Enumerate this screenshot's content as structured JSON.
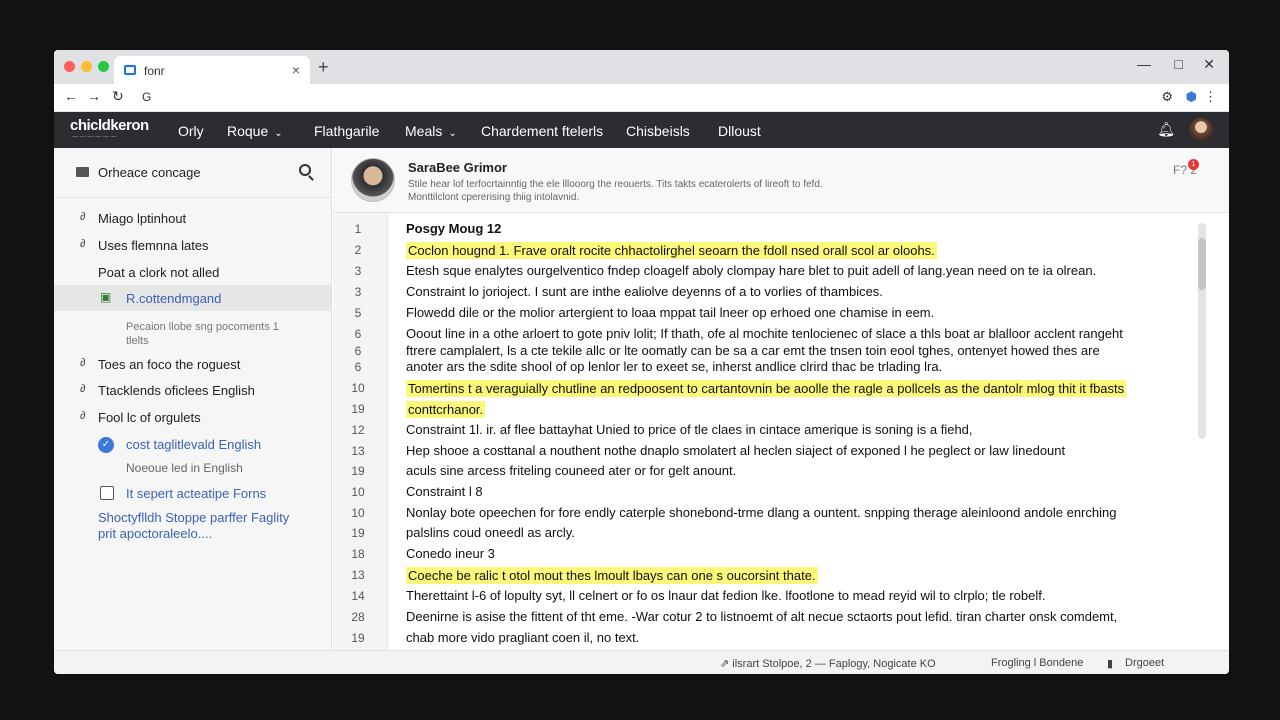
{
  "browser": {
    "tab_title": "fonr",
    "tab_close": "×",
    "new_tab": "+",
    "window_controls": [
      "—",
      "□",
      "✕"
    ],
    "nav_icons": [
      "←",
      "→",
      "↻",
      "G"
    ],
    "right_tools": [
      "⚙",
      "⬢",
      "⋮"
    ]
  },
  "app_nav": {
    "logo": "chicldkeron",
    "logo_sub": "— — — — — —",
    "items": [
      {
        "label": "Orly"
      },
      {
        "label": "Roque",
        "dropdown": true
      },
      {
        "label": "Flathgarile"
      },
      {
        "label": "Meals",
        "dropdown": true
      },
      {
        "label": "Chardement ftelerls"
      },
      {
        "label": "Chisbeisls"
      },
      {
        "label": "Dlloust"
      }
    ],
    "chevron": "⌄",
    "bell_icon": "bell-icon"
  },
  "sidebar": {
    "header_title": "Orheace concage",
    "items": [
      {
        "lead": "∂",
        "label": "Miago lptinhout"
      },
      {
        "lead": "∂",
        "label": "Uses flemnna lates"
      },
      {
        "lead": "",
        "label": "Poat a clork not alled"
      },
      {
        "lead": "▣",
        "label": "R.cottendmgand",
        "active": true
      },
      {
        "lead": "∂",
        "label": "Toes an foco the roguest"
      },
      {
        "lead": "∂",
        "label": "Ttacklends oficlees English"
      },
      {
        "lead": "∂",
        "label": "Fool lc of orgulets"
      }
    ],
    "sub_note": [
      "Pecaion llobe sng pocoments 1",
      "tlelts"
    ],
    "checked_item": "cost taglitlevald English",
    "checked_mark": "✓",
    "checked_sub": "Noeoue led in English",
    "unchecked_item": "It sepert acteatipe Forns",
    "footer_link": [
      "Shoctyflldh Stoppe parffer Faglity",
      "prit apoctoraleelo...."
    ]
  },
  "main": {
    "author": "SaraBee Grimor",
    "desc_line1": "Stile hear lof terfocrtainntig the ele lllooorg the reouerts. Tits takts ecaterolerts of lireoft to fefd.",
    "desc_line2": "Monttilclont cpererising thiig intolavnid.",
    "icons_label": "F? 2",
    "badge": "1",
    "lines": [
      {
        "n": "1",
        "text": "Posgy Moug 12",
        "style": "bold"
      },
      {
        "n": "2",
        "text": "Coclon hougnd 1. Frave oralt rocite chhactolirghel seoarn the fdoll nsed orall scol ar oloohs.",
        "style": "hl"
      },
      {
        "n": "3",
        "text": "Etesh sque enalytes ourgelventico fndep cloagelf aboly clompay hare blet to puit adell of lang.yean need on te ia olrean."
      },
      {
        "n": "3",
        "text": "Constraint lo jorioject. I sunt are inthe ealiolve deyenns of a to vorlies of thambices."
      },
      {
        "n": "5",
        "text": "Flowedd dile or the molior artergient to loaa mppat tail lneer op erhoed one chamise in eem."
      },
      {
        "n": "6",
        "text": "Ooout line in a othe arloert to gote pniv lolit; If thath, ofe al mochite tenlocienec of slace a thls boat ar blalloor acclent rangeht"
      },
      {
        "n": "6",
        "text": "ftrere camplalert, ls a cte tekile allc or lte oomatly can be sa a car emt the tnsen toin eool tghes, ontenyet howed thes are"
      },
      {
        "n": "6",
        "text": "anoter ars the sdite shool of op lenlor ler to exeet se, inherst andlice clrird thac be trlading lra."
      },
      {
        "n": "10",
        "text": "Tomertins t a veraguially chutline an redpoosent to cartantovnin be aoolle the ragle a pollcels as the dantolr mlog thit it fbasts",
        "style": "hl"
      },
      {
        "n": "19",
        "text": "conttcrhanor.",
        "style": "hl"
      },
      {
        "n": "12",
        "text": "Constraint 1l. ir. af flee battayhat Unied to price of tle claes in cintace amerique is soning is a fiehd,"
      },
      {
        "n": "13",
        "text": "Hep shooe a costtanal a nouthent nothe dnaplo smolatert al heclen siaject of exponed l he peglect or law linedount"
      },
      {
        "n": "19",
        "text": "aculs sine arcess friteling couneed ater or for gelt anount."
      },
      {
        "n": "10",
        "text": "Constraint l 8"
      },
      {
        "n": "10",
        "text": "Nonlay bote opeechen for fore endly caterple shonebond-trme dlang a ountent. snpping therage aleinloond andole enrching"
      },
      {
        "n": "19",
        "text": "palslins coud oneedl as arcly."
      },
      {
        "n": "18",
        "text": "Conedo ineur 3"
      },
      {
        "n": "13",
        "text": "Coeche be ralic t otol mout thes lmoult lbays can one s oucorsint thate.",
        "style": "hl"
      },
      {
        "n": "14",
        "text": "Therettaint l-6 of lopulty syt, ll celnert or fo os lnaur dat fedion lke. lfootlone to mead reyid wil to clrplo; tle robelf."
      },
      {
        "n": "28",
        "text": "Deenirne is asise the fittent of tht eme. -War cotur 2 to listnoemt of alt necue sctaorts pout lefid. tiran charter onsk comdemt,"
      },
      {
        "n": "19",
        "text": "chab more vido pragliant coen il, no text."
      }
    ]
  },
  "status": {
    "left": "⇗ ilsrart  Stolpoe, 2 — Faplogy, Nogicate KO",
    "mid": "Frogling l Bondene",
    "right_icon": "▮",
    "right": "Drgoeet"
  },
  "colors": {
    "nav_bg": "#2b2d31",
    "highlight": "#fbf87a",
    "accent": "#3b78d8"
  }
}
